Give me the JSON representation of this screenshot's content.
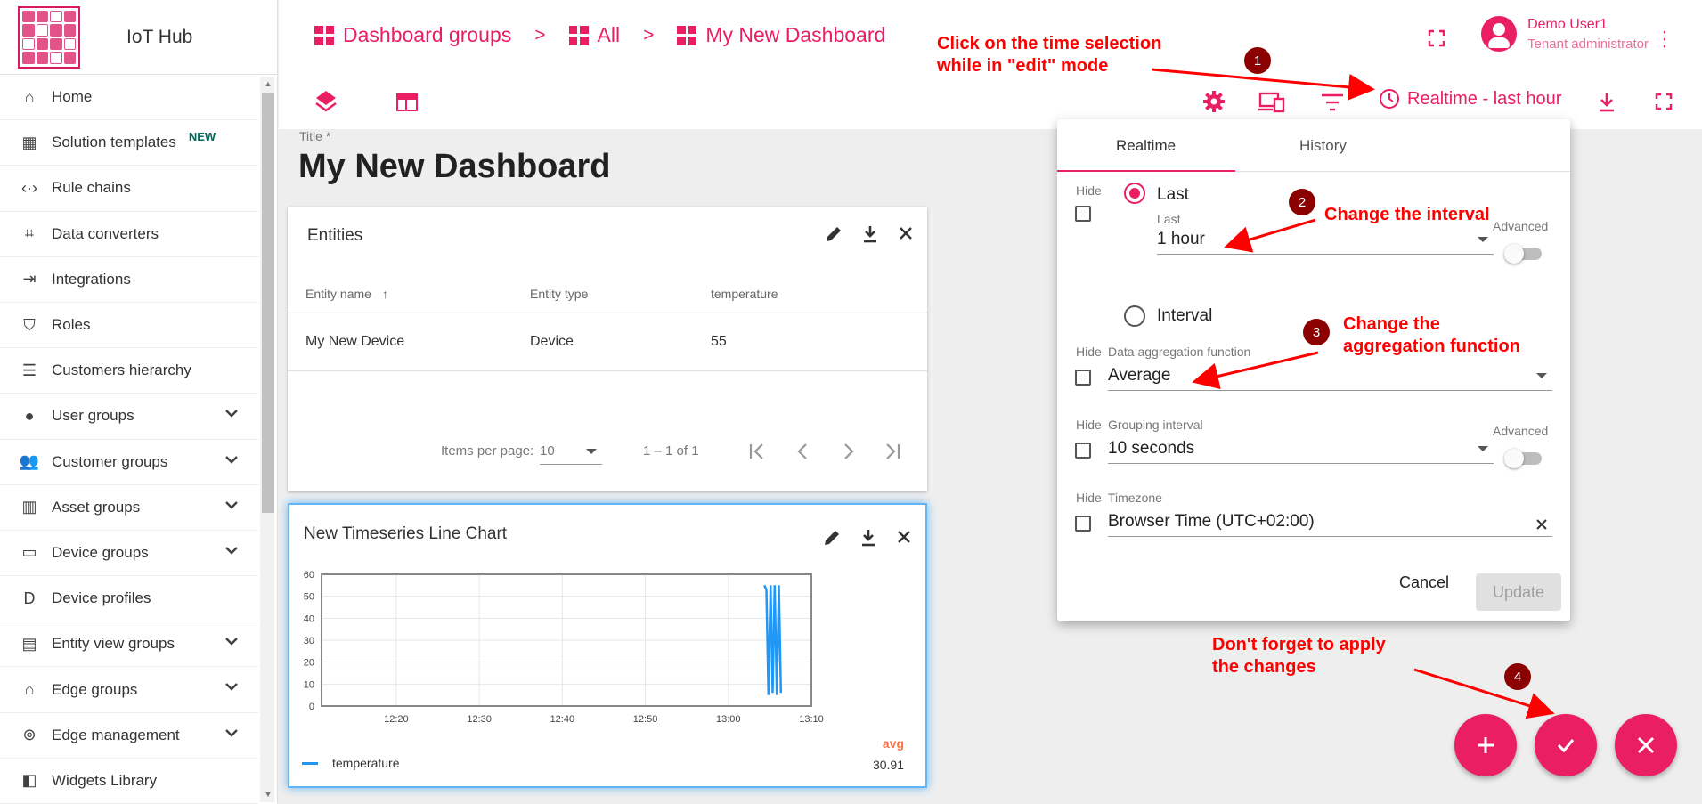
{
  "app": {
    "name": "IoT Hub"
  },
  "sidebar": {
    "items": [
      {
        "label": "Home",
        "icon": "home-icon"
      },
      {
        "label": "Solution templates",
        "icon": "apps-icon",
        "badge": "NEW"
      },
      {
        "label": "Rule chains",
        "icon": "settings-ethernet-icon"
      },
      {
        "label": "Data converters",
        "icon": "transform-icon"
      },
      {
        "label": "Integrations",
        "icon": "input-icon"
      },
      {
        "label": "Roles",
        "icon": "shield-icon"
      },
      {
        "label": "Customers hierarchy",
        "icon": "sort-icon"
      },
      {
        "label": "User groups",
        "icon": "account-circle-icon",
        "expandable": true
      },
      {
        "label": "Customer groups",
        "icon": "supervisor-account-icon",
        "expandable": true
      },
      {
        "label": "Asset groups",
        "icon": "domain-icon",
        "expandable": true
      },
      {
        "label": "Device groups",
        "icon": "devices-other-icon",
        "expandable": true
      },
      {
        "label": "Device profiles",
        "icon": "device-profile-icon"
      },
      {
        "label": "Entity view groups",
        "icon": "view-quilt-icon",
        "expandable": true
      },
      {
        "label": "Edge groups",
        "icon": "router-icon",
        "expandable": true
      },
      {
        "label": "Edge management",
        "icon": "settings-input-antenna-icon",
        "expandable": true
      },
      {
        "label": "Widgets Library",
        "icon": "widgets-icon"
      }
    ]
  },
  "breadcrumbs": [
    {
      "label": "Dashboard groups"
    },
    {
      "label": "All"
    },
    {
      "label": "My New Dashboard"
    }
  ],
  "breadcrumb_separator": ">",
  "user": {
    "name": "Demo User1",
    "role": "Tenant administrator"
  },
  "timewindow": {
    "label": "Realtime - last hour"
  },
  "dashboard": {
    "title_label": "Title *",
    "title": "My New Dashboard"
  },
  "entities_widget": {
    "title": "Entities",
    "columns": [
      "Entity name",
      "Entity type",
      "temperature"
    ],
    "rows": [
      [
        "My New Device",
        "Device",
        "55"
      ]
    ],
    "pager": {
      "items_per_page_label": "Items per page:",
      "page_size": "10",
      "range": "1 – 1 of 1"
    }
  },
  "chart_widget": {
    "title": "New Timeseries Line Chart",
    "legend_header": "avg",
    "legend": [
      {
        "name": "temperature",
        "avg": "30.91",
        "color": "#2196f3"
      }
    ]
  },
  "chart_data": {
    "type": "line",
    "title": "New Timeseries Line Chart",
    "xlabel": "",
    "ylabel": "",
    "ylim": [
      0,
      60
    ],
    "yticks": [
      "0",
      "10",
      "20",
      "30",
      "40",
      "50",
      "60"
    ],
    "xticks": [
      "12:20",
      "12:30",
      "12:40",
      "12:50",
      "13:00",
      "13:10"
    ],
    "xlim": [
      "12:11",
      "13:10"
    ],
    "grid": true,
    "legend_position": "bottom",
    "series": [
      {
        "name": "temperature",
        "color": "#2196f3",
        "x": [
          "13:04:20",
          "13:04:35",
          "13:04:50",
          "13:05:05",
          "13:05:20",
          "13:05:35",
          "13:05:50",
          "13:06:05",
          "13:06:20"
        ],
        "values": [
          55,
          53,
          5,
          55,
          6,
          55,
          5,
          55,
          6
        ]
      }
    ]
  },
  "popup": {
    "tabs": [
      "Realtime",
      "History"
    ],
    "hide_label": "Hide",
    "last_option": "Last",
    "last_field_label": "Last",
    "last_value": "1 hour",
    "advanced_label": "Advanced",
    "interval_option": "Interval",
    "aggregation_label": "Data aggregation function",
    "aggregation_value": "Average",
    "grouping_label": "Grouping interval",
    "grouping_value": "10 seconds",
    "timezone_label": "Timezone",
    "timezone_value": "Browser Time (UTC+02:00)",
    "cancel": "Cancel",
    "update": "Update"
  },
  "annotations": {
    "a1": "Click on the time selection\nwhile in \"edit\" mode",
    "a2": "Change the interval",
    "a3": "Change the\naggregation function",
    "a4": "Don't forget to apply\nthe changes",
    "n1": "1",
    "n2": "2",
    "n3": "3",
    "n4": "4",
    "color": "#ff0000"
  },
  "colors": {
    "accent": "#e91e63",
    "series": "#2196f3"
  }
}
